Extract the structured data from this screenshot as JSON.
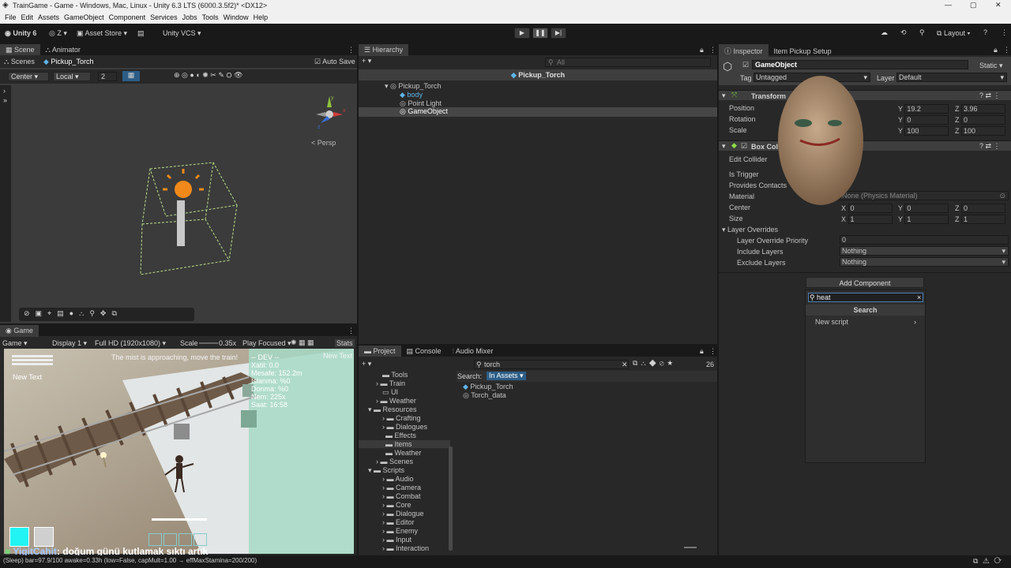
{
  "title": "TrainGame - Game - Windows, Mac, Linux - Unity 6.3 LTS (6000.3.5f2)* <DX12>",
  "menu": [
    "File",
    "Edit",
    "Assets",
    "GameObject",
    "Component",
    "Services",
    "Jobs",
    "Tools",
    "Window",
    "Help"
  ],
  "toolbar": {
    "account": "Unity 6",
    "z": "Z",
    "asset_store": "Asset Store",
    "vcs": "Unity VCS",
    "layout": "Layout"
  },
  "scene": {
    "tab": "Scene",
    "tab2": "Animator",
    "breadcrumb": "Scenes",
    "object": "Pickup_Torch",
    "auto_save": "Auto Save",
    "pivot": "Center",
    "space": "Local",
    "snap": "2",
    "persp": "< Persp"
  },
  "game": {
    "tab": "Game",
    "mode": "Game",
    "display": "Display 1",
    "resolution": "Full HD (1920x1080)",
    "scale_label": "Scale",
    "scale": "0.35x",
    "play_focused": "Play Focused",
    "stats": "Stats",
    "banner": "The mist is approaching, move the train!",
    "new_text_left": "New Text",
    "new_text_right": "New Text",
    "dev_lines": [
      "-- DEV --",
      "Xatil: 0.0",
      "Mesafe: 152.2m",
      "Islanma: %0",
      "Donma: %0",
      "Nem: 225x",
      "Saat: 16:58"
    ],
    "chat_name": "YigitCahit",
    "chat_msg": ": doğum günü kutlamak sıktı artık"
  },
  "hierarchy": {
    "tab": "Hierarchy",
    "search": "All",
    "scene_name": "Pickup_Torch",
    "items": [
      "Pickup_Torch",
      "body",
      "Point Light",
      "GameObject"
    ]
  },
  "inspector": {
    "tab": "Inspector",
    "tab2": "Item Pickup Setup",
    "object_name": "GameObject",
    "static": "Static",
    "tag_label": "Tag",
    "tag": "Untagged",
    "layer_label": "Layer",
    "layer": "Default",
    "transform": {
      "title": "Transform",
      "position": "Position",
      "rotation": "Rotation",
      "scale": "Scale",
      "pos_y": "19.2",
      "pos_z": "3.96",
      "rot_y": "0",
      "rot_z": "0",
      "scale_y": "100",
      "scale_z": "100"
    },
    "collider": {
      "title": "Box Collid",
      "edit": "Edit Collider",
      "is_trigger": "Is Trigger",
      "provides": "Provides Contacts",
      "material": "Material",
      "material_val": "None (Physics Material)",
      "center": "Center",
      "size": "Size",
      "cx": "0",
      "cy": "0",
      "cz": "0",
      "sx": "1",
      "sy": "1",
      "sz": "1"
    },
    "layer_overrides": "Layer Overrides",
    "priority_label": "Layer Override Priority",
    "priority": "0",
    "include_label": "Include Layers",
    "include": "Nothing",
    "exclude_label": "Exclude Layers",
    "exclude": "Nothing",
    "add_component": "Add Component",
    "search_value": "heat",
    "search_header": "Search",
    "new_script": "New script"
  },
  "project": {
    "tabs": [
      "Project",
      "Console",
      "Audio Mixer"
    ],
    "search": "torch",
    "search_label": "Search:",
    "in_assets": "In Assets",
    "count": "26",
    "tree": [
      "Tools",
      "Train",
      "UI",
      "Weather",
      "Resources",
      "Crafting",
      "Dialogues",
      "Effects",
      "Items",
      "Weather",
      "Scenes",
      "Scripts",
      "Audio",
      "Camera",
      "Combat",
      "Core",
      "Dialogue",
      "Editor",
      "Enemy",
      "Input",
      "Interaction"
    ],
    "results": [
      "Pickup_Torch",
      "Torch_data"
    ]
  },
  "status": "(Sleep) bar=97.9/100 awake=0.33h (low=False, capMult=1.00 → effMaxStamina=200/200)"
}
